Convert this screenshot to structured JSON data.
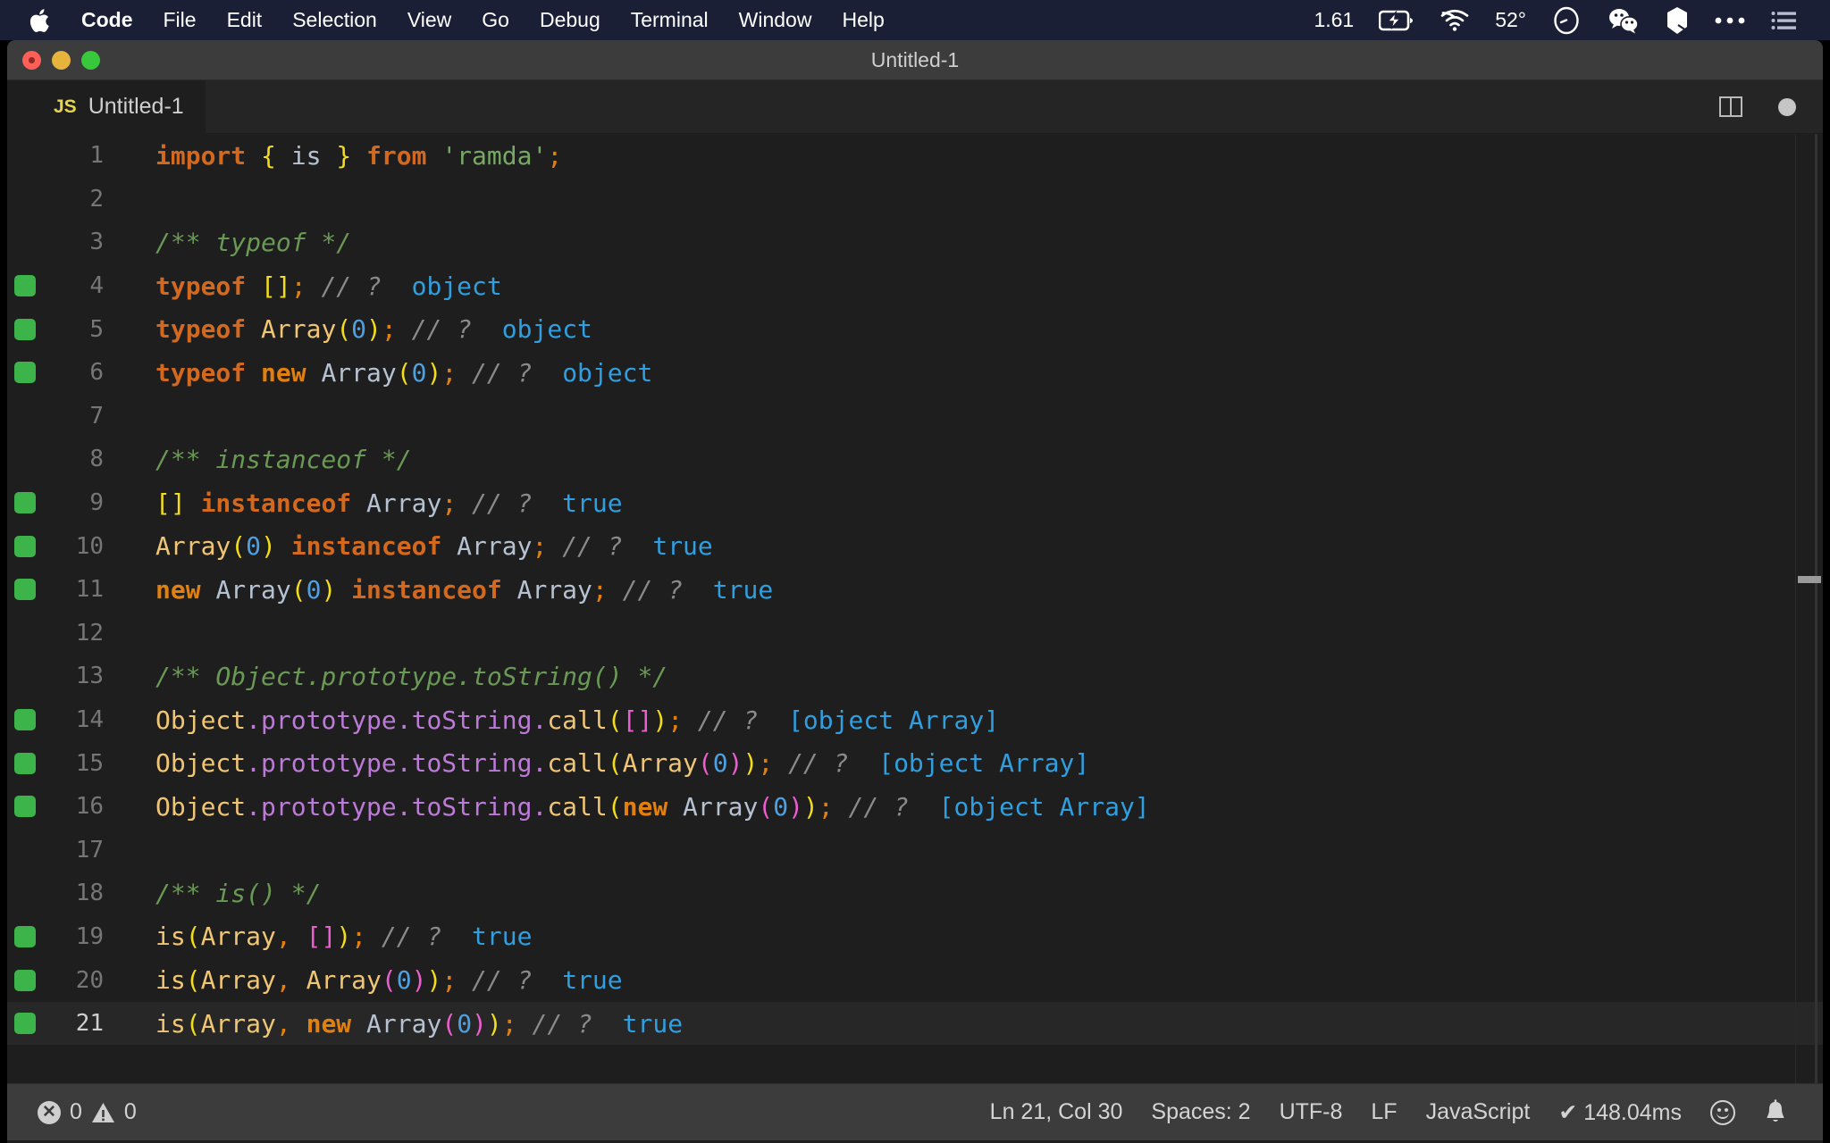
{
  "menubar": {
    "apple_icon": "apple-logo",
    "items": [
      {
        "label": "Code",
        "bold": true
      },
      {
        "label": "File",
        "bold": false
      },
      {
        "label": "Edit",
        "bold": false
      },
      {
        "label": "Selection",
        "bold": false
      },
      {
        "label": "View",
        "bold": false
      },
      {
        "label": "Go",
        "bold": false
      },
      {
        "label": "Debug",
        "bold": false
      },
      {
        "label": "Terminal",
        "bold": false
      },
      {
        "label": "Window",
        "bold": false
      },
      {
        "label": "Help",
        "bold": false
      }
    ],
    "status": {
      "load": "1.61",
      "battery_icon": "battery-charging-icon",
      "wifi_icon": "wifi-icon",
      "temperature": "52°",
      "dnd_icon": "clock-circle-icon",
      "wechat_icon": "wechat-icon",
      "marker_icon": "marker-pen-icon",
      "more_icon": "ellipsis-icon",
      "list_icon": "control-center-list-icon"
    }
  },
  "window": {
    "title": "Untitled-1",
    "traffic_lights": [
      "close",
      "minimize",
      "zoom"
    ]
  },
  "tabbar": {
    "tab": {
      "icon": "JS",
      "label": "Untitled-1"
    },
    "split_editor_label": "split-editor",
    "dirty_label": "unsaved-changes"
  },
  "editor": {
    "colors": {
      "background": "#1e1e1e",
      "active_line": "#272727",
      "gutter_added": "#3cb44a",
      "keyword": "#d2691e",
      "string": "#77a865",
      "comment": "#6a9955",
      "trailing_comment": "#8a8a8a",
      "number": "#4ea0e0",
      "value": "#2f9fe0",
      "function": "#f0c674",
      "property": "#bb7bd6",
      "bracket_yellow": "#f2dc1b",
      "bracket_magenta": "#ea5ed0",
      "punctuation": "#e2800f",
      "line_number": "#767676"
    },
    "lines": [
      {
        "n": "1",
        "mark": false,
        "active": false,
        "tokens": [
          {
            "t": "import",
            "c": "t-kw"
          },
          {
            "t": " ",
            "c": "t-var"
          },
          {
            "t": "{",
            "c": "t-punc-y"
          },
          {
            "t": " is ",
            "c": "t-var"
          },
          {
            "t": "}",
            "c": "t-punc-y"
          },
          {
            "t": " ",
            "c": "t-var"
          },
          {
            "t": "from",
            "c": "t-kw"
          },
          {
            "t": " ",
            "c": "t-var"
          },
          {
            "t": "'ramda'",
            "c": "t-str"
          },
          {
            "t": ";",
            "c": "t-semi"
          }
        ]
      },
      {
        "n": "2",
        "mark": false,
        "active": false,
        "tokens": []
      },
      {
        "n": "3",
        "mark": false,
        "active": false,
        "tokens": [
          {
            "t": "/** typeof */",
            "c": "t-cmt"
          }
        ]
      },
      {
        "n": "4",
        "mark": true,
        "active": false,
        "tokens": [
          {
            "t": "typeof",
            "c": "t-kw"
          },
          {
            "t": " ",
            "c": "t-var"
          },
          {
            "t": "[]",
            "c": "t-punc-y"
          },
          {
            "t": ";",
            "c": "t-semi"
          },
          {
            "t": " ",
            "c": "t-var"
          },
          {
            "t": "// ? ",
            "c": "t-cmt2"
          },
          {
            "t": " object",
            "c": "t-val"
          }
        ]
      },
      {
        "n": "5",
        "mark": true,
        "active": false,
        "tokens": [
          {
            "t": "typeof",
            "c": "t-kw"
          },
          {
            "t": " ",
            "c": "t-var"
          },
          {
            "t": "Array",
            "c": "t-fn"
          },
          {
            "t": "(",
            "c": "t-punc-y"
          },
          {
            "t": "0",
            "c": "t-num"
          },
          {
            "t": ")",
            "c": "t-punc-y"
          },
          {
            "t": ";",
            "c": "t-semi"
          },
          {
            "t": " ",
            "c": "t-var"
          },
          {
            "t": "// ? ",
            "c": "t-cmt2"
          },
          {
            "t": " object",
            "c": "t-val"
          }
        ]
      },
      {
        "n": "6",
        "mark": true,
        "active": false,
        "tokens": [
          {
            "t": "typeof",
            "c": "t-kw"
          },
          {
            "t": " ",
            "c": "t-var"
          },
          {
            "t": "new",
            "c": "t-kw2"
          },
          {
            "t": " ",
            "c": "t-var"
          },
          {
            "t": "Array",
            "c": "t-var"
          },
          {
            "t": "(",
            "c": "t-punc-y"
          },
          {
            "t": "0",
            "c": "t-num"
          },
          {
            "t": ")",
            "c": "t-punc-y"
          },
          {
            "t": ";",
            "c": "t-semi"
          },
          {
            "t": " ",
            "c": "t-var"
          },
          {
            "t": "// ? ",
            "c": "t-cmt2"
          },
          {
            "t": " object",
            "c": "t-val"
          }
        ]
      },
      {
        "n": "7",
        "mark": false,
        "active": false,
        "tokens": []
      },
      {
        "n": "8",
        "mark": false,
        "active": false,
        "tokens": [
          {
            "t": "/** instanceof */",
            "c": "t-cmt"
          }
        ]
      },
      {
        "n": "9",
        "mark": true,
        "active": false,
        "tokens": [
          {
            "t": "[]",
            "c": "t-punc-y"
          },
          {
            "t": " ",
            "c": "t-var"
          },
          {
            "t": "instanceof",
            "c": "t-kw"
          },
          {
            "t": " ",
            "c": "t-var"
          },
          {
            "t": "Array",
            "c": "t-var"
          },
          {
            "t": ";",
            "c": "t-semi"
          },
          {
            "t": " ",
            "c": "t-var"
          },
          {
            "t": "// ? ",
            "c": "t-cmt2"
          },
          {
            "t": " true",
            "c": "t-val"
          }
        ]
      },
      {
        "n": "10",
        "mark": true,
        "active": false,
        "tokens": [
          {
            "t": "Array",
            "c": "t-fn"
          },
          {
            "t": "(",
            "c": "t-punc-y"
          },
          {
            "t": "0",
            "c": "t-num"
          },
          {
            "t": ")",
            "c": "t-punc-y"
          },
          {
            "t": " ",
            "c": "t-var"
          },
          {
            "t": "instanceof",
            "c": "t-kw"
          },
          {
            "t": " ",
            "c": "t-var"
          },
          {
            "t": "Array",
            "c": "t-var"
          },
          {
            "t": ";",
            "c": "t-semi"
          },
          {
            "t": " ",
            "c": "t-var"
          },
          {
            "t": "// ? ",
            "c": "t-cmt2"
          },
          {
            "t": " true",
            "c": "t-val"
          }
        ]
      },
      {
        "n": "11",
        "mark": true,
        "active": false,
        "tokens": [
          {
            "t": "new",
            "c": "t-kw2"
          },
          {
            "t": " ",
            "c": "t-var"
          },
          {
            "t": "Array",
            "c": "t-var"
          },
          {
            "t": "(",
            "c": "t-punc-y"
          },
          {
            "t": "0",
            "c": "t-num"
          },
          {
            "t": ")",
            "c": "t-punc-y"
          },
          {
            "t": " ",
            "c": "t-var"
          },
          {
            "t": "instanceof",
            "c": "t-kw"
          },
          {
            "t": " ",
            "c": "t-var"
          },
          {
            "t": "Array",
            "c": "t-var"
          },
          {
            "t": ";",
            "c": "t-semi"
          },
          {
            "t": " ",
            "c": "t-var"
          },
          {
            "t": "// ? ",
            "c": "t-cmt2"
          },
          {
            "t": " true",
            "c": "t-val"
          }
        ]
      },
      {
        "n": "12",
        "mark": false,
        "active": false,
        "tokens": []
      },
      {
        "n": "13",
        "mark": false,
        "active": false,
        "tokens": [
          {
            "t": "/** Object.prototype.toString() */",
            "c": "t-cmt"
          }
        ]
      },
      {
        "n": "14",
        "mark": true,
        "active": false,
        "tokens": [
          {
            "t": "Object",
            "c": "t-fn"
          },
          {
            "t": ".",
            "c": "t-dot"
          },
          {
            "t": "prototype",
            "c": "t-prop"
          },
          {
            "t": ".",
            "c": "t-dot"
          },
          {
            "t": "toString",
            "c": "t-prop"
          },
          {
            "t": ".",
            "c": "t-dot"
          },
          {
            "t": "call",
            "c": "t-fn"
          },
          {
            "t": "(",
            "c": "t-punc-y"
          },
          {
            "t": "[]",
            "c": "t-punc-m"
          },
          {
            "t": ")",
            "c": "t-punc-y"
          },
          {
            "t": ";",
            "c": "t-semi"
          },
          {
            "t": " ",
            "c": "t-var"
          },
          {
            "t": "// ? ",
            "c": "t-cmt2"
          },
          {
            "t": " [object Array]",
            "c": "t-val"
          }
        ]
      },
      {
        "n": "15",
        "mark": true,
        "active": false,
        "tokens": [
          {
            "t": "Object",
            "c": "t-fn"
          },
          {
            "t": ".",
            "c": "t-dot"
          },
          {
            "t": "prototype",
            "c": "t-prop"
          },
          {
            "t": ".",
            "c": "t-dot"
          },
          {
            "t": "toString",
            "c": "t-prop"
          },
          {
            "t": ".",
            "c": "t-dot"
          },
          {
            "t": "call",
            "c": "t-fn"
          },
          {
            "t": "(",
            "c": "t-punc-y"
          },
          {
            "t": "Array",
            "c": "t-fn"
          },
          {
            "t": "(",
            "c": "t-punc-m"
          },
          {
            "t": "0",
            "c": "t-num"
          },
          {
            "t": ")",
            "c": "t-punc-m"
          },
          {
            "t": ")",
            "c": "t-punc-y"
          },
          {
            "t": ";",
            "c": "t-semi"
          },
          {
            "t": " ",
            "c": "t-var"
          },
          {
            "t": "// ? ",
            "c": "t-cmt2"
          },
          {
            "t": " [object Array]",
            "c": "t-val"
          }
        ]
      },
      {
        "n": "16",
        "mark": true,
        "active": false,
        "tokens": [
          {
            "t": "Object",
            "c": "t-fn"
          },
          {
            "t": ".",
            "c": "t-dot"
          },
          {
            "t": "prototype",
            "c": "t-prop"
          },
          {
            "t": ".",
            "c": "t-dot"
          },
          {
            "t": "toString",
            "c": "t-prop"
          },
          {
            "t": ".",
            "c": "t-dot"
          },
          {
            "t": "call",
            "c": "t-fn"
          },
          {
            "t": "(",
            "c": "t-punc-y"
          },
          {
            "t": "new",
            "c": "t-kw2"
          },
          {
            "t": " ",
            "c": "t-var"
          },
          {
            "t": "Array",
            "c": "t-var"
          },
          {
            "t": "(",
            "c": "t-punc-m"
          },
          {
            "t": "0",
            "c": "t-num"
          },
          {
            "t": ")",
            "c": "t-punc-m"
          },
          {
            "t": ")",
            "c": "t-punc-y"
          },
          {
            "t": ";",
            "c": "t-semi"
          },
          {
            "t": " ",
            "c": "t-var"
          },
          {
            "t": "// ? ",
            "c": "t-cmt2"
          },
          {
            "t": " [object Array]",
            "c": "t-val"
          }
        ]
      },
      {
        "n": "17",
        "mark": false,
        "active": false,
        "tokens": []
      },
      {
        "n": "18",
        "mark": false,
        "active": false,
        "tokens": [
          {
            "t": "/** is() */",
            "c": "t-cmt"
          }
        ]
      },
      {
        "n": "19",
        "mark": true,
        "active": false,
        "tokens": [
          {
            "t": "is",
            "c": "t-fn"
          },
          {
            "t": "(",
            "c": "t-punc-y"
          },
          {
            "t": "Array",
            "c": "t-fn"
          },
          {
            "t": ",",
            "c": "t-semi"
          },
          {
            "t": " ",
            "c": "t-var"
          },
          {
            "t": "[]",
            "c": "t-punc-m"
          },
          {
            "t": ")",
            "c": "t-punc-y"
          },
          {
            "t": ";",
            "c": "t-semi"
          },
          {
            "t": " ",
            "c": "t-var"
          },
          {
            "t": "// ? ",
            "c": "t-cmt2"
          },
          {
            "t": " true",
            "c": "t-val"
          }
        ]
      },
      {
        "n": "20",
        "mark": true,
        "active": false,
        "tokens": [
          {
            "t": "is",
            "c": "t-fn"
          },
          {
            "t": "(",
            "c": "t-punc-y"
          },
          {
            "t": "Array",
            "c": "t-fn"
          },
          {
            "t": ",",
            "c": "t-semi"
          },
          {
            "t": " ",
            "c": "t-var"
          },
          {
            "t": "Array",
            "c": "t-fn"
          },
          {
            "t": "(",
            "c": "t-punc-m"
          },
          {
            "t": "0",
            "c": "t-num"
          },
          {
            "t": ")",
            "c": "t-punc-m"
          },
          {
            "t": ")",
            "c": "t-punc-y"
          },
          {
            "t": ";",
            "c": "t-semi"
          },
          {
            "t": " ",
            "c": "t-var"
          },
          {
            "t": "// ? ",
            "c": "t-cmt2"
          },
          {
            "t": " true",
            "c": "t-val"
          }
        ]
      },
      {
        "n": "21",
        "mark": true,
        "active": true,
        "tokens": [
          {
            "t": "is",
            "c": "t-fn"
          },
          {
            "t": "(",
            "c": "t-punc-y"
          },
          {
            "t": "Array",
            "c": "t-fn"
          },
          {
            "t": ",",
            "c": "t-semi"
          },
          {
            "t": " ",
            "c": "t-var"
          },
          {
            "t": "new",
            "c": "t-kw2"
          },
          {
            "t": " ",
            "c": "t-var"
          },
          {
            "t": "Array",
            "c": "t-var"
          },
          {
            "t": "(",
            "c": "t-punc-m"
          },
          {
            "t": "0",
            "c": "t-num"
          },
          {
            "t": ")",
            "c": "t-punc-m"
          },
          {
            "t": ")",
            "c": "t-punc-y"
          },
          {
            "t": ";",
            "c": "t-semi"
          },
          {
            "t": " ",
            "c": "t-var"
          },
          {
            "t": "// ? ",
            "c": "t-cmt2"
          },
          {
            "t": " true",
            "c": "t-val"
          }
        ]
      }
    ]
  },
  "statusbar": {
    "errors": "0",
    "warnings": "0",
    "cursor": "Ln 21, Col 30",
    "indent": "Spaces: 2",
    "encoding": "UTF-8",
    "eol": "LF",
    "language": "JavaScript",
    "timing": "✔ 148.04ms",
    "smiley_label": "feedback-smiley",
    "bell_label": "notifications-bell"
  }
}
